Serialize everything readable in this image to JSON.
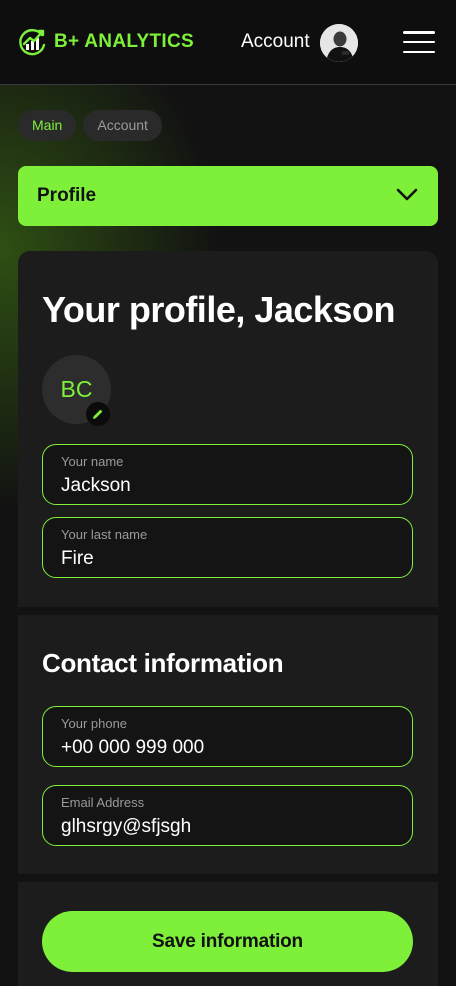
{
  "brand": {
    "name": "B+ ANALYTICS",
    "accent": "#7ef03a"
  },
  "header": {
    "account_label": "Account",
    "avatar_icon": "user-avatar",
    "menu_icon": "hamburger-menu-icon"
  },
  "breadcrumbs": [
    {
      "label": "Main",
      "active": true
    },
    {
      "label": "Account",
      "active": false
    }
  ],
  "section_select": {
    "label": "Profile",
    "icon": "chevron-down-icon"
  },
  "profile": {
    "title": "Your profile, Jackson",
    "initials": "BC",
    "edit_icon": "pencil-icon",
    "fields": [
      {
        "label": "Your name",
        "value": "Jackson"
      },
      {
        "label": "Your last name",
        "value": "Fire"
      }
    ]
  },
  "contact": {
    "title": "Contact information",
    "fields": [
      {
        "label": "Your phone",
        "value": "+00 000 999 000"
      },
      {
        "label": "Email Address",
        "value": "glhsrgy@sfjsgh"
      }
    ]
  },
  "actions": {
    "save_label": "Save information"
  },
  "colors": {
    "background": "#121212",
    "card": "#1c1c1c",
    "accent": "#7ef03a",
    "muted_text": "#9a9a9a"
  }
}
